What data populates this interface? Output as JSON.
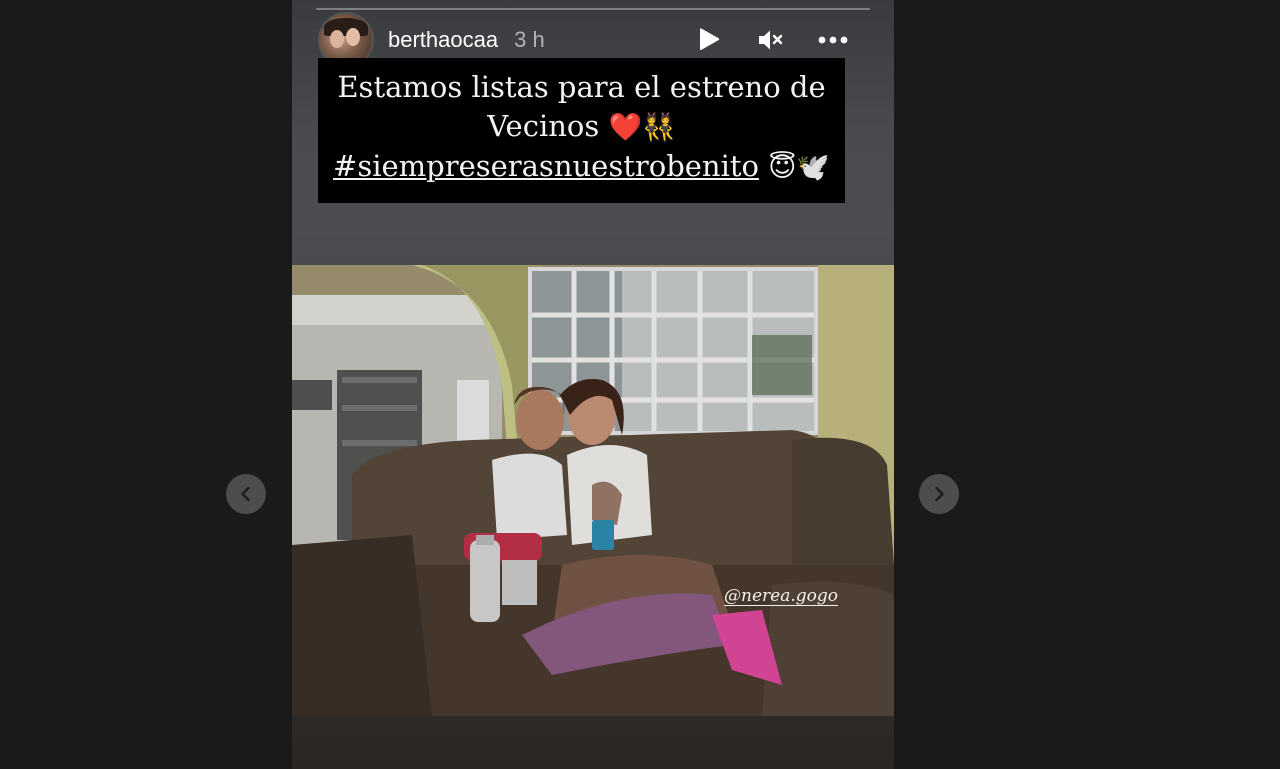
{
  "story": {
    "username": "berthaocaa",
    "time_ago": "3 h",
    "caption": {
      "line1": "Estamos listas para el estreno de",
      "line2": "Vecinos",
      "line2_emoji": "❤️👯",
      "hashtag": "#siempreserasnuestrobenito",
      "hashtag_emoji": "😇🕊️"
    },
    "photo_mention": "@nerea.gogo"
  },
  "icons": {
    "play": "play-icon",
    "mute": "muted-speaker-icon",
    "more": "more-options-icon",
    "prev": "chevron-left-icon",
    "next": "chevron-right-icon"
  },
  "colors": {
    "page_background": "#1a1a1a",
    "caption_background": "#000000",
    "text": "#ffffff"
  }
}
